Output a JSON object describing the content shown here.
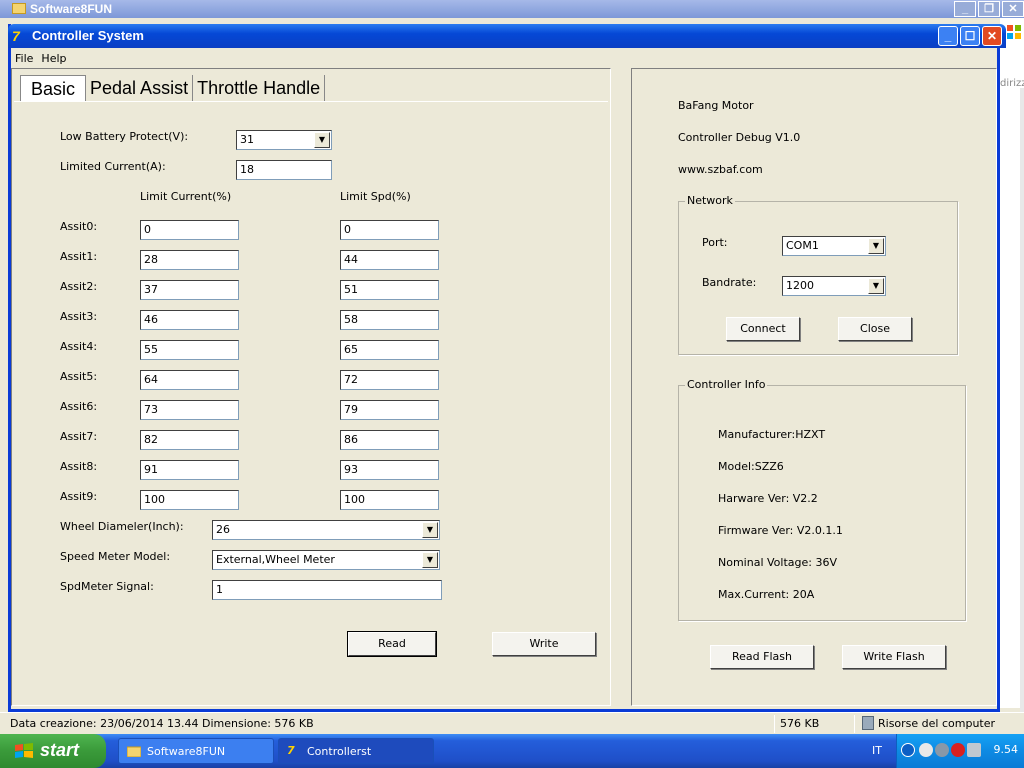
{
  "background_window": {
    "title": "Software8FUN",
    "side_text": "dirizz"
  },
  "window": {
    "title": "Controller System"
  },
  "menu": [
    "File",
    "Help"
  ],
  "tabs": [
    "Basic",
    "Pedal Assist",
    "Throttle Handle"
  ],
  "basic": {
    "low_battery_label": "Low Battery Protect(V):",
    "low_battery_value": "31",
    "limited_current_label": "Limited Current(A):",
    "limited_current_value": "18",
    "col_current": "Limit Current(%)",
    "col_speed": "Limit Spd(%)",
    "assist": [
      {
        "label": "Assit0:",
        "current": "0",
        "speed": "0"
      },
      {
        "label": "Assit1:",
        "current": "28",
        "speed": "44"
      },
      {
        "label": "Assit2:",
        "current": "37",
        "speed": "51"
      },
      {
        "label": "Assit3:",
        "current": "46",
        "speed": "58"
      },
      {
        "label": "Assit4:",
        "current": "55",
        "speed": "65"
      },
      {
        "label": "Assit5:",
        "current": "64",
        "speed": "72"
      },
      {
        "label": "Assit6:",
        "current": "73",
        "speed": "79"
      },
      {
        "label": "Assit7:",
        "current": "82",
        "speed": "86"
      },
      {
        "label": "Assit8:",
        "current": "91",
        "speed": "93"
      },
      {
        "label": "Assit9:",
        "current": "100",
        "speed": "100"
      }
    ],
    "wheel_label": "Wheel Diameler(Inch):",
    "wheel_value": "26",
    "speed_meter_label": "Speed Meter Model:",
    "speed_meter_value": "External,Wheel Meter",
    "signal_label": "SpdMeter Signal:",
    "signal_value": "1",
    "read_label": "Read",
    "write_label": "Write"
  },
  "info": {
    "line1": "BaFang Motor",
    "line2": "Controller Debug V1.0",
    "line3": "www.szbaf.com"
  },
  "network": {
    "title": "Network",
    "port_label": "Port:",
    "port_value": "COM1",
    "baud_label": "Bandrate:",
    "baud_value": "1200",
    "connect_label": "Connect",
    "close_label": "Close"
  },
  "controller_info": {
    "title": "Controller Info",
    "manufacturer": "Manufacturer:HZXT",
    "model": "Model:SZZ6",
    "hardware": "Harware Ver: V2.2",
    "firmware": "Firmware Ver: V2.0.1.1",
    "voltage": "Nominal Voltage: 36V",
    "current": "Max.Current: 20A"
  },
  "flash": {
    "read_label": "Read Flash",
    "write_label": "Write Flash"
  },
  "statusbar": {
    "info": "Data creazione: 23/06/2014 13.44 Dimensione: 576 KB",
    "size": "576 KB",
    "location": "Risorse del computer"
  },
  "taskbar": {
    "start_label": "start",
    "tasks": [
      "Software8FUN",
      "Controllerst"
    ],
    "language": "IT",
    "clock": "9.54"
  }
}
